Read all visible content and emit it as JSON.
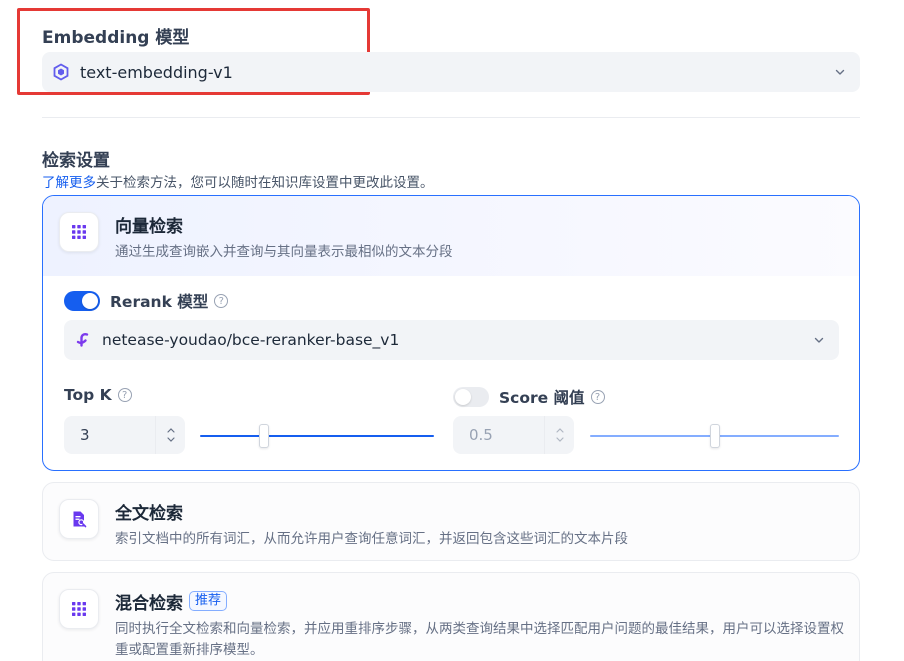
{
  "embedding": {
    "title": "Embedding 模型",
    "model": "text-embedding-v1",
    "icon": "tongyi-logo-icon"
  },
  "retrieval": {
    "title": "检索设置",
    "learn_more": "了解更多",
    "description": "关于检索方法，您可以随时在知识库设置中更改此设置。",
    "methods": [
      {
        "title": "向量检索",
        "description": "通过生成查询嵌入并查询与其向量表示最相似的文本分段",
        "icon": "grid-dots-icon",
        "active": true,
        "rerank": {
          "enabled": true,
          "label": "Rerank 模型",
          "model": "netease-youdao/bce-reranker-base_v1",
          "icon": "siliconflow-logo-icon"
        },
        "top_k": {
          "label": "Top K",
          "value": "3",
          "slider_fraction": 0.275
        },
        "score_threshold": {
          "label": "Score 阈值",
          "enabled": false,
          "value": "0.5",
          "slider_fraction": 0.5
        }
      },
      {
        "title": "全文检索",
        "description": "索引文档中的所有词汇，从而允许用户查询任意词汇，并返回包含这些词汇的文本片段",
        "icon": "document-search-icon",
        "active": false
      },
      {
        "title": "混合检索",
        "badge": "推荐",
        "description": "同时执行全文检索和向量检索，并应用重排序步骤，从两类查询结果中选择匹配用户问题的最佳结果，用户可以选择设置权重或配置重新排序模型。",
        "icon": "grid-dots-icon",
        "active": false
      }
    ]
  },
  "colors": {
    "accent": "#155eef",
    "highlight": "#e53935",
    "icon_purple": "#6938ef"
  },
  "help_glyph": "?"
}
